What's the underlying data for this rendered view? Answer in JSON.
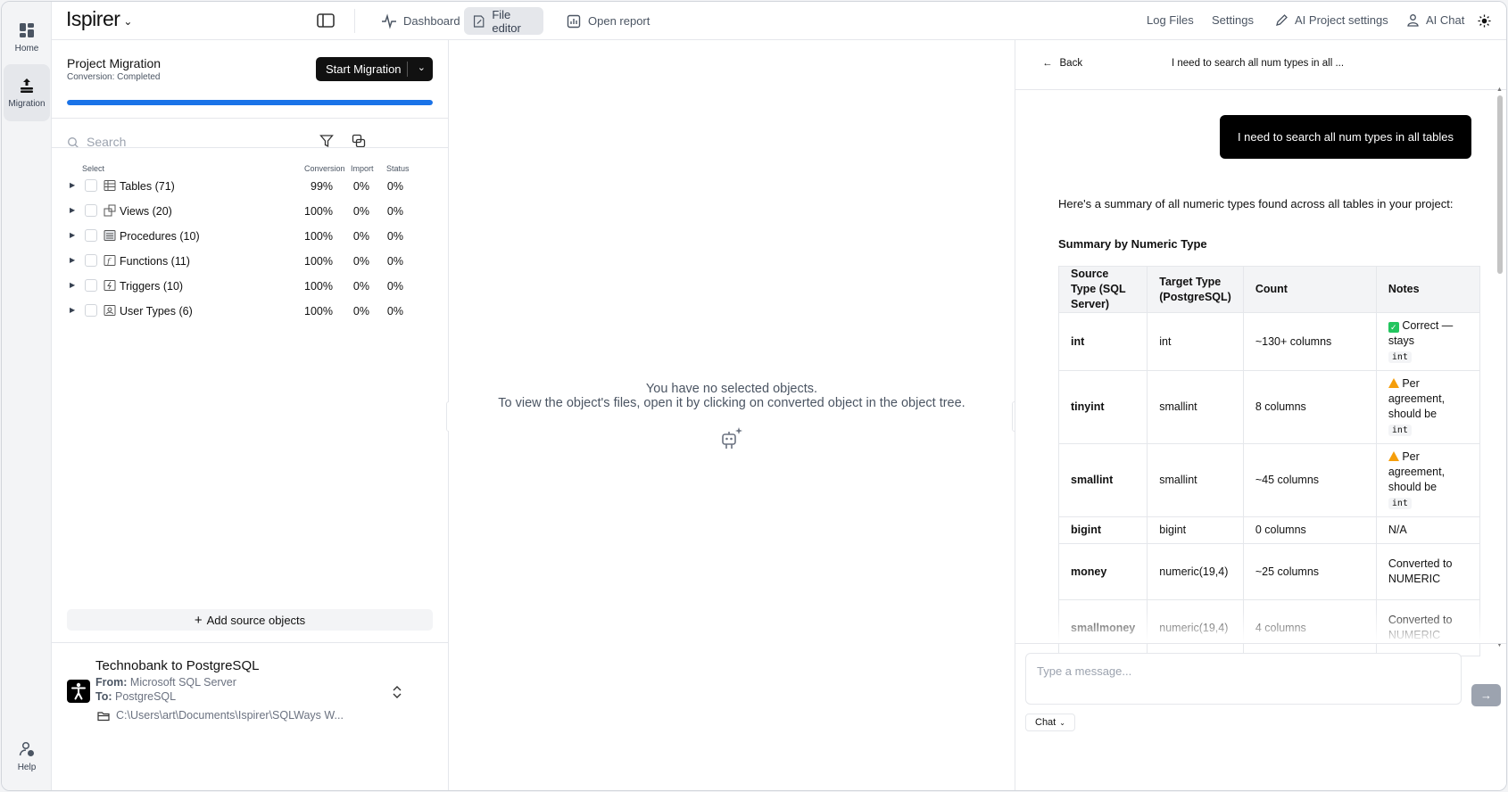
{
  "rail": {
    "home_label": "Home",
    "migration_label": "Migration",
    "help_label": "Help"
  },
  "topbar": {
    "brand": "Ispirer",
    "tabs": [
      {
        "label": "Dashboard",
        "icon": "pulse-icon"
      },
      {
        "label": "File editor",
        "icon": "edit-file-icon"
      },
      {
        "label": "Open report",
        "icon": "report-icon"
      }
    ],
    "links": {
      "log_files": "Log Files",
      "settings": "Settings",
      "ai_project_settings": "AI Project settings",
      "ai_chat": "AI Chat"
    }
  },
  "project": {
    "title": "Project Migration",
    "status": "Conversion: Completed",
    "start_button": "Start Migration",
    "progress": 1.0,
    "accent": "#1a73e8"
  },
  "search": {
    "placeholder": "Search"
  },
  "tree": {
    "headers": {
      "select": "Select",
      "conversion": "Conversion",
      "import": "Import",
      "status": "Status"
    },
    "rows": [
      {
        "label": "Tables (71)",
        "conversion": "99%",
        "import": "0%",
        "status": "0%",
        "icon": "table-icon"
      },
      {
        "label": "Views (20)",
        "conversion": "100%",
        "import": "0%",
        "status": "0%",
        "icon": "views-icon"
      },
      {
        "label": "Procedures (10)",
        "conversion": "100%",
        "import": "0%",
        "status": "0%",
        "icon": "procedure-icon"
      },
      {
        "label": "Functions (11)",
        "conversion": "100%",
        "import": "0%",
        "status": "0%",
        "icon": "function-icon"
      },
      {
        "label": "Triggers (10)",
        "conversion": "100%",
        "import": "0%",
        "status": "0%",
        "icon": "trigger-icon"
      },
      {
        "label": "User Types (6)",
        "conversion": "100%",
        "import": "0%",
        "status": "0%",
        "icon": "user-type-icon"
      }
    ],
    "add_button": "Add source objects"
  },
  "footer": {
    "title": "Technobank to PostgreSQL",
    "from_label": "From:",
    "from_value": "Microsoft SQL Server",
    "to_label": "To:",
    "to_value": "PostgreSQL",
    "path": "C:\\Users\\art\\Documents\\Ispirer\\SQLWays W..."
  },
  "editor": {
    "empty_line1": "You have no selected objects.",
    "empty_line2": "To view the object's files, open it by clicking on converted object in the object tree."
  },
  "chat": {
    "back_label": "Back",
    "title": "I need to search all num types in all ...",
    "user_message": "I need to search all num types in all tables",
    "response_intro": "Here's a summary of all numeric types found across all tables in your project:",
    "response_heading": "Summary by Numeric Type",
    "table": {
      "headers": [
        "Source Type (SQL Server)",
        "Target Type (PostgreSQL)",
        "Count",
        "Notes"
      ],
      "rows": [
        {
          "source": "int",
          "target": "int",
          "count": "~130+ columns",
          "note_icon": "ok",
          "note": "Correct — stays",
          "note_code": "int"
        },
        {
          "source": "tinyint",
          "target": "smallint",
          "count": "8 columns",
          "note_icon": "warn",
          "note": "Per agreement, should be",
          "note_code": "int"
        },
        {
          "source": "smallint",
          "target": "smallint",
          "count": "~45 columns",
          "note_icon": "warn",
          "note": "Per agreement, should be",
          "note_code": "int"
        },
        {
          "source": "bigint",
          "target": "bigint",
          "count": "0 columns",
          "note_icon": "",
          "note": "N/A",
          "note_code": ""
        },
        {
          "source": "money",
          "target": "numeric(19,4)",
          "count": "~25 columns",
          "note_icon": "",
          "note": "Converted to NUMERIC",
          "note_code": ""
        },
        {
          "source": "smallmoney",
          "target": "numeric(19,4)",
          "count": "4 columns",
          "note_icon": "",
          "note": "Converted to NUMERIC",
          "note_code": ""
        }
      ]
    },
    "input_placeholder": "Type a message...",
    "mode_label": "Chat"
  }
}
